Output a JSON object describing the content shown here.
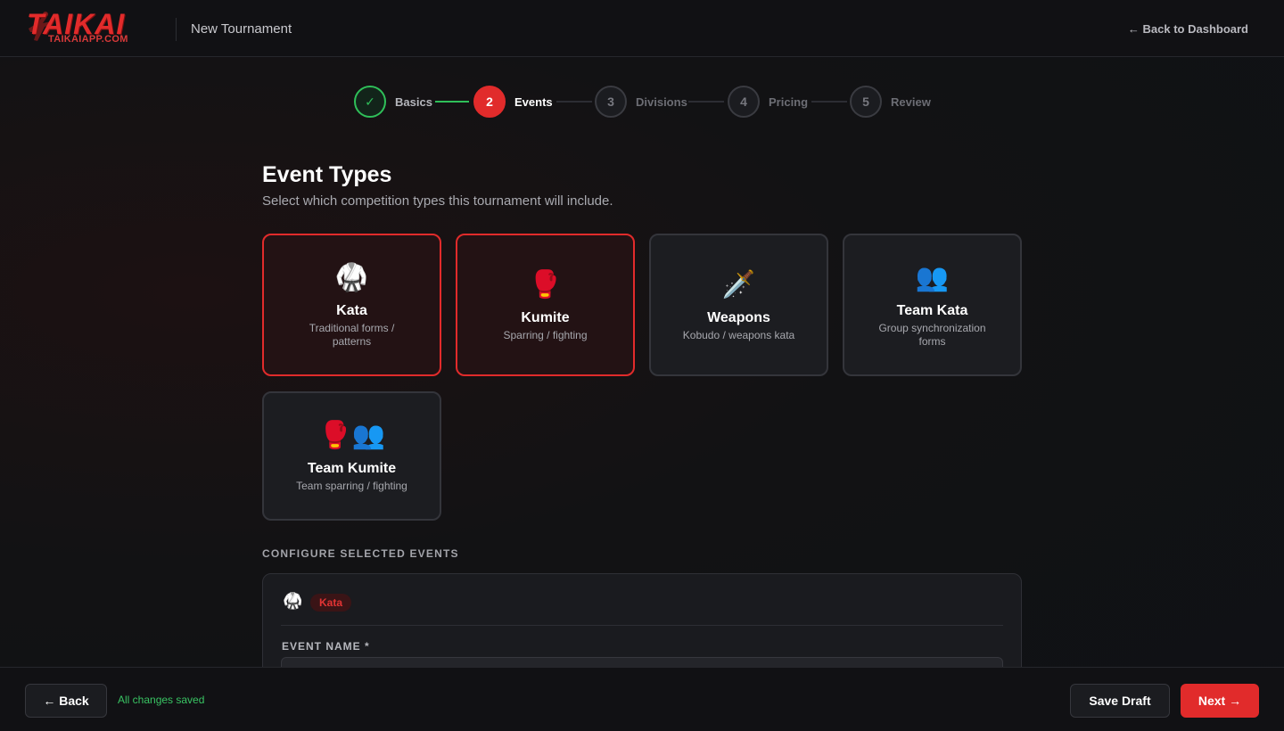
{
  "header": {
    "logo_text": "TAIKAI",
    "logo_subtext": "TAIKAIAPP.COM",
    "title": "New Tournament",
    "back_link": "← Back to Dashboard"
  },
  "stepper": {
    "steps": [
      {
        "number": "✓",
        "label": "Basics",
        "state": "done"
      },
      {
        "number": "2",
        "label": "Events",
        "state": "active"
      },
      {
        "number": "3",
        "label": "Divisions",
        "state": "upcoming"
      },
      {
        "number": "4",
        "label": "Pricing",
        "state": "upcoming"
      },
      {
        "number": "5",
        "label": "Review",
        "state": "upcoming"
      }
    ]
  },
  "main": {
    "title": "Event Types",
    "subtitle": "Select which competition types this tournament will include."
  },
  "event_types": [
    {
      "icon": "🥋",
      "icon_name": "karate-gi-icon",
      "name": "Kata",
      "description": "Traditional forms / patterns",
      "selected": true
    },
    {
      "icon": "🥊",
      "icon_name": "boxing-glove-icon",
      "name": "Kumite",
      "description": "Sparring / fighting",
      "selected": true
    },
    {
      "icon": "🗡️",
      "icon_name": "dagger-icon",
      "name": "Weapons",
      "description": "Kobudo / weapons kata",
      "selected": false
    },
    {
      "icon": "👥",
      "icon_name": "group-icon",
      "name": "Team Kata",
      "description": "Group synchronization forms",
      "selected": false
    },
    {
      "icon": "🥊👥",
      "icon_name": "team-sparring-icon",
      "name": "Team Kumite",
      "description": "Team sparring / fighting",
      "selected": false
    }
  ],
  "configure": {
    "section_label": "CONFIGURE SELECTED EVENTS",
    "event_icon": "🥋",
    "event_badge": "Kata",
    "field_label": "EVENT NAME *",
    "field_value": ""
  },
  "footer": {
    "back_label": "← Back",
    "saved_status": "All changes saved",
    "save_draft_label": "Save Draft",
    "next_label": "Next →"
  },
  "colors": {
    "accent": "#e12b2b",
    "success": "#2fbf59",
    "background": "#121214"
  }
}
